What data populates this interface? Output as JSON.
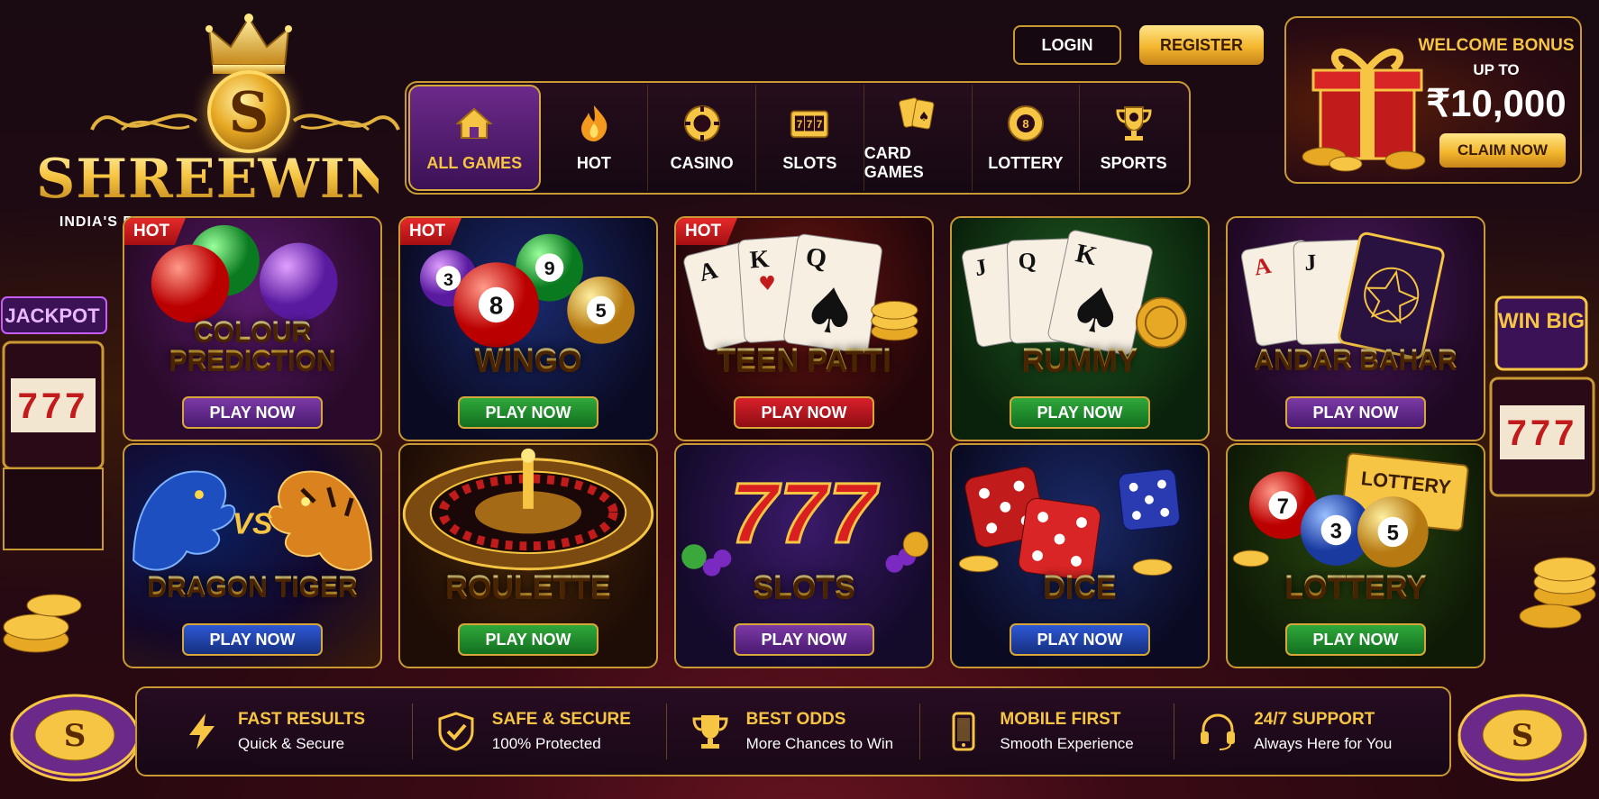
{
  "brand": {
    "logo_letter": "S",
    "name": "SHREEWIN",
    "tagline": "INDIA'S FAVOURITE GAMING PLATFORM",
    "colors": {
      "gold": "#f6c543",
      "purple": "#4a1a70",
      "bg": "#1a0a12"
    }
  },
  "auth": {
    "login_label": "LOGIN",
    "register_label": "REGISTER"
  },
  "nav": {
    "items": [
      {
        "label": "ALL GAMES",
        "icon": "home-icon",
        "active": true
      },
      {
        "label": "HOT",
        "icon": "flame-icon"
      },
      {
        "label": "CASINO",
        "icon": "poker-chip-icon"
      },
      {
        "label": "SLOTS",
        "icon": "slot-machine-icon"
      },
      {
        "label": "CARD GAMES",
        "icon": "playing-cards-icon"
      },
      {
        "label": "LOTTERY",
        "icon": "lottery-ball-icon"
      },
      {
        "label": "SPORTS",
        "icon": "trophy-icon"
      }
    ]
  },
  "bonus": {
    "title": "WELCOME BONUS",
    "upto": "UP TO",
    "amount": "₹10,000",
    "claim_label": "CLAIM NOW",
    "icon": "gift-box-icon"
  },
  "side": {
    "left_sign": "JACKPOT",
    "left_reels": "777",
    "right_sign": "WIN BIG",
    "right_reels": "777",
    "chip_letter": "S"
  },
  "games": [
    {
      "title": "COLOUR PREDICTION",
      "hot": "HOT",
      "play": "PLAY NOW",
      "button_color": "purple",
      "art": "colour-balls-icon"
    },
    {
      "title": "WINGO",
      "hot": "HOT",
      "play": "PLAY NOW",
      "button_color": "green",
      "art": "number-balls-icon",
      "balls": [
        "3",
        "9",
        "8",
        "5"
      ]
    },
    {
      "title": "TEEN PATTI",
      "hot": "HOT",
      "play": "PLAY NOW",
      "button_color": "red",
      "art": "playing-cards-icon",
      "cards": [
        "A",
        "K",
        "Q"
      ]
    },
    {
      "title": "RUMMY",
      "play": "PLAY NOW",
      "button_color": "green",
      "art": "playing-cards-icon",
      "cards": [
        "J",
        "Q",
        "K"
      ]
    },
    {
      "title": "ANDAR BAHAR",
      "play": "PLAY NOW",
      "button_color": "purple",
      "art": "playing-cards-icon",
      "cards": [
        "A",
        "J"
      ]
    },
    {
      "title": "DRAGON TIGER",
      "play": "PLAY NOW",
      "button_color": "blue",
      "art": "dragon-tiger-icon",
      "vs": "VS"
    },
    {
      "title": "ROULETTE",
      "play": "PLAY NOW",
      "button_color": "green",
      "art": "roulette-wheel-icon"
    },
    {
      "title": "SLOTS",
      "play": "PLAY NOW",
      "button_color": "purple",
      "art": "triple-seven-icon",
      "sevens": "777"
    },
    {
      "title": "DICE",
      "play": "PLAY NOW",
      "button_color": "blue",
      "art": "dice-icon"
    },
    {
      "title": "LOTTERY",
      "play": "PLAY NOW",
      "button_color": "green",
      "art": "lottery-ticket-icon",
      "ticket": "LOTTERY",
      "balls": [
        "7",
        "3",
        "5"
      ]
    }
  ],
  "features": [
    {
      "title": "FAST RESULTS",
      "subtitle": "Quick & Secure",
      "icon": "lightning-icon"
    },
    {
      "title": "SAFE & SECURE",
      "subtitle": "100% Protected",
      "icon": "shield-check-icon"
    },
    {
      "title": "BEST ODDS",
      "subtitle": "More Chances to Win",
      "icon": "trophy-icon"
    },
    {
      "title": "MOBILE FIRST",
      "subtitle": "Smooth Experience",
      "icon": "mobile-phone-icon"
    },
    {
      "title": "24/7 SUPPORT",
      "subtitle": "Always Here for You",
      "icon": "headset-icon"
    }
  ]
}
